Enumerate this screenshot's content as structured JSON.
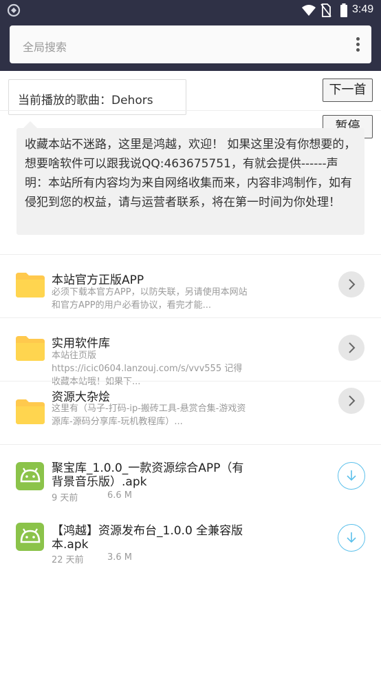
{
  "status_bar": {
    "time": "3:49",
    "icons": [
      "app-notification-icon",
      "wifi-icon",
      "no-sim-icon",
      "battery-icon"
    ]
  },
  "search": {
    "placeholder": "全局搜索"
  },
  "player": {
    "now_playing": "当前播放的歌曲：Dehors",
    "next_label": "下一首",
    "pause_label": "暂停"
  },
  "notice": {
    "text": "收藏本站不迷路，这里是鸿越，欢迎！ 如果这里没有你想要的，想要啥软件可以跟我说QQ:463675751，有就会提供------声明：本站所有内容均为来自网络收集而来，内容非鸿制作，如有侵犯到您的权益，请与运营者联系，将在第一时间为你处理！"
  },
  "folders": [
    {
      "title": "本站官方正版APP",
      "desc": "必须下载本官方APP，以防失联，另请使用本网站和官方APP的用户必看协议，看完才能..."
    },
    {
      "title": "实用软件库",
      "desc": "本站往页版\nhttps://icic0604.lanzouj.com/s/vvv555 记得收藏本站哦！如果下..."
    },
    {
      "title": "资源大杂烩",
      "desc": "这里有（马子-打码-ip-搬砖工具-悬赏合集-游戏资源库-源码分享库-玩机教程库）..."
    }
  ],
  "files": [
    {
      "title": "聚宝库_1.0.0_一款资源综合APP（有背景音乐版）.apk",
      "time": "9 天前",
      "size": "6.6 M"
    },
    {
      "title": "【鸿越】资源发布台_1.0.0 全兼容版本.apk",
      "time": "22 天前",
      "size": "3.6 M"
    }
  ],
  "colors": {
    "header_bg": "#2f3146",
    "folder_yellow": "#ffd54f",
    "android_green": "#8bc34a",
    "download_blue": "#5bc0eb"
  }
}
